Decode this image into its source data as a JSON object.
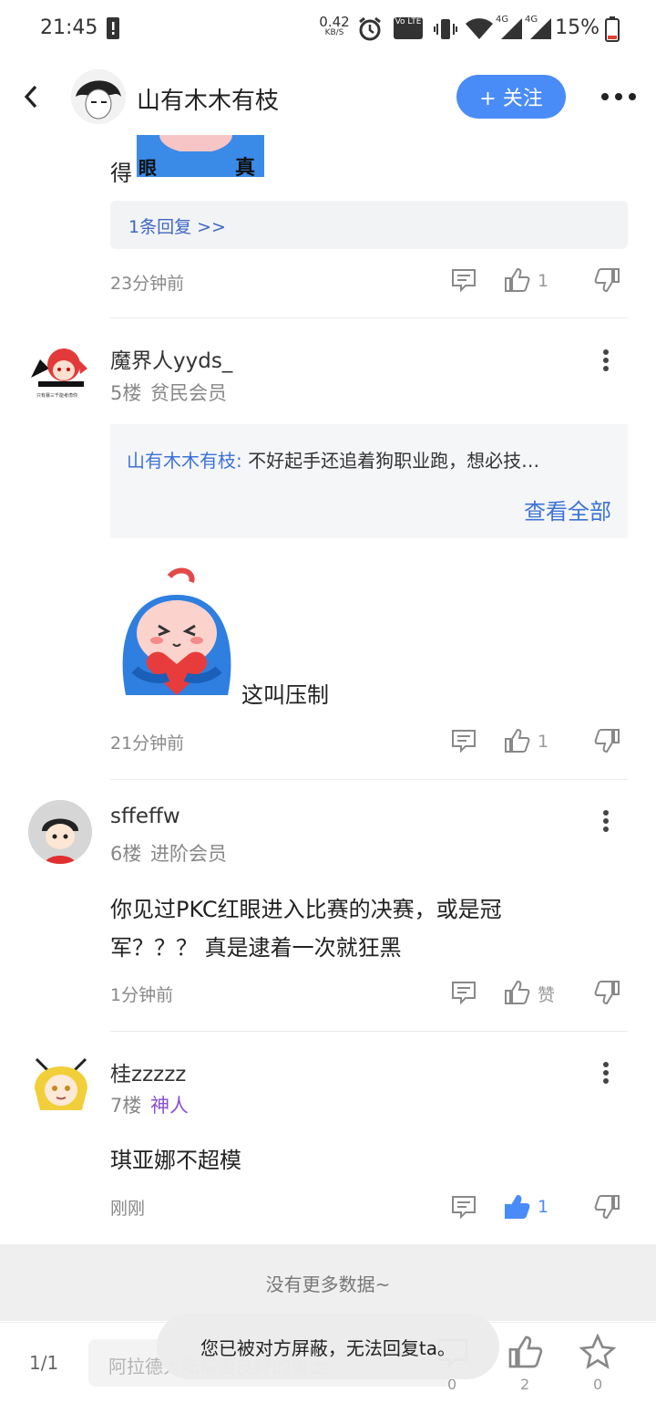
{
  "status_bar": {
    "time": "21:45",
    "net_speed_value": "0.42",
    "net_speed_unit": "KB/S",
    "battery_percent": "15%",
    "volte_label": "Vo LTE",
    "signal_label_1": "4G",
    "signal_label_2": "4G"
  },
  "header": {
    "title": "山有木木有枝",
    "follow_label": "+ 关注",
    "back_icon": "back-arrow-icon",
    "more_icon": "more-horizontal-icon"
  },
  "top_fragment": {
    "text_left": "得",
    "sticker_text_1": "眼",
    "sticker_text_2": "真",
    "reply_link": "1条回复 >>",
    "time": "23分钟前",
    "like_count": "1"
  },
  "comments": [
    {
      "username": "魔界人yyds_",
      "floor": "5楼",
      "level": "贫民会员",
      "avatar_caption": "只有暴三千能考虑你",
      "quote_name": "山有木木有枝:",
      "quote_text": " 不好起手还追着狗职业跑，想必技…",
      "view_all": "查看全部",
      "body": "这叫压制",
      "time": "21分钟前",
      "like": "1"
    },
    {
      "username": "sffeffw",
      "floor": "6楼",
      "level": "进阶会员",
      "body_line1": "你见过PKC红眼进入比赛的决赛，或是冠",
      "body_line2": "军？？？ 真是逮着一次就狂黑",
      "time": "1分钟前",
      "like": "赞"
    },
    {
      "username": "桂zzzzz",
      "floor": "7楼",
      "level": "神人",
      "body": "琪亚娜不超模",
      "time": "刚刚",
      "like": "1"
    }
  ],
  "colors": {
    "accent": "#4a8cf7",
    "link": "#3d72d6",
    "level_purple": "#8a4fd1"
  },
  "footer": {
    "no_more": "没有更多数据~",
    "page_indicator": "1/1",
    "input_placeholder": "阿拉德大陆需要友好的勇士",
    "comment_count": "0",
    "like_count": "2",
    "star_count": "0",
    "toast": "您已被对方屏蔽，无法回复ta。"
  }
}
